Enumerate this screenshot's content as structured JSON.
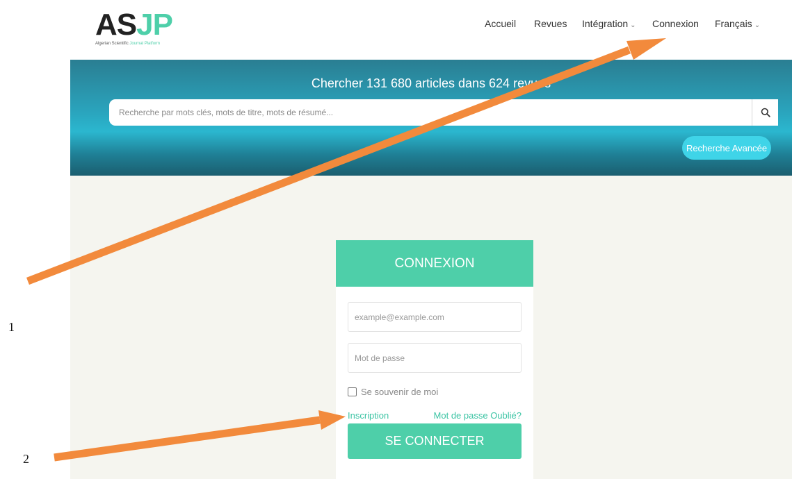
{
  "header": {
    "logo": {
      "main_left": "AS",
      "main_right": "JP",
      "subtitle_left": "Algerian Scientific",
      "subtitle_right": "Journal Platform"
    },
    "nav": [
      {
        "label": "Accueil",
        "dropdown": false
      },
      {
        "label": "Revues",
        "dropdown": false
      },
      {
        "label": "Intégration",
        "dropdown": true
      },
      {
        "label": "Connexion",
        "dropdown": false
      },
      {
        "label": "Français",
        "dropdown": true
      }
    ]
  },
  "banner": {
    "title": "Chercher 131 680 articles dans 624 revues",
    "search_placeholder": "Recherche par mots clés, mots de titre, mots de résumé...",
    "search_icon": "search-icon",
    "advanced_label": "Recherche Avancée"
  },
  "login": {
    "title": "CONNEXION",
    "email_placeholder": "example@example.com",
    "password_placeholder": "Mot de passe",
    "remember_label": "Se souvenir de moi",
    "register_link": "Inscription",
    "forgot_link": "Mot de passe Oublié?",
    "submit_label": "SE CONNECTER"
  },
  "annotations": {
    "label_1": "1",
    "label_2": "2"
  },
  "colors": {
    "brand_green": "#4ecfa9",
    "banner_teal": "#2bb7cf",
    "arrow_orange": "#f28a3c",
    "button_cyan": "#3fd4e8"
  }
}
